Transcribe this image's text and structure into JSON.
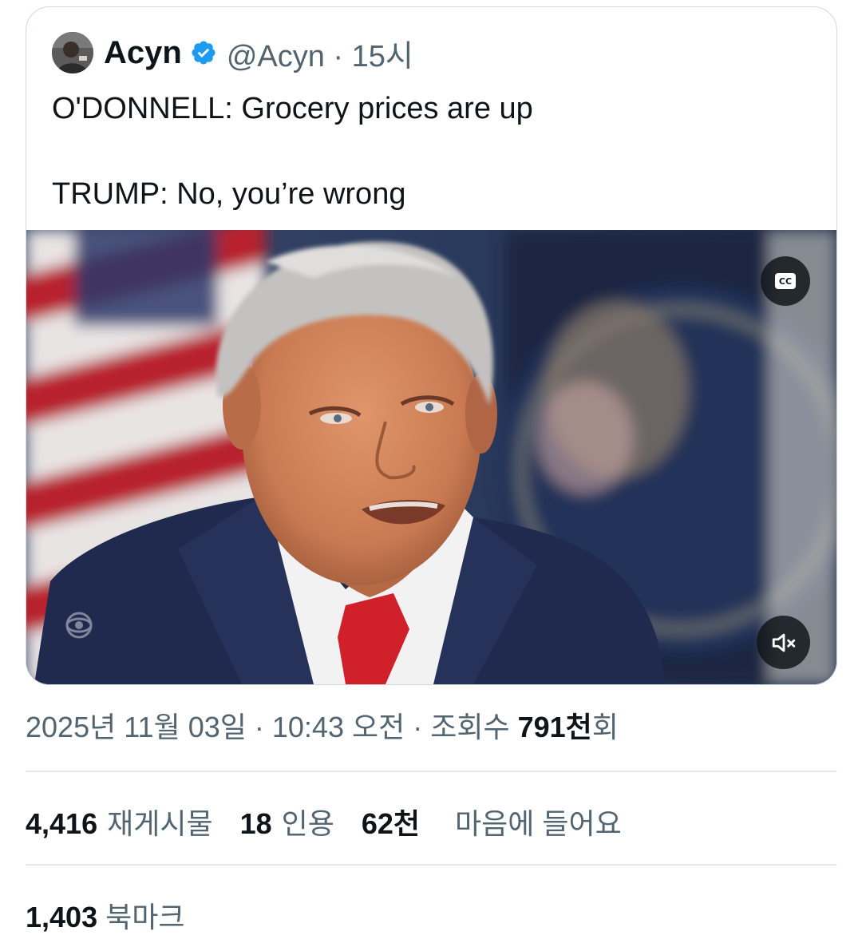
{
  "quoted_tweet": {
    "display_name": "Acyn",
    "handle": "@Acyn",
    "time_sep": " · ",
    "time": "15시",
    "text_line1": "O'DONNELL: Grocery prices are up",
    "text_line2": "TRUMP: No, you’re wrong",
    "media": {
      "cc_label": "CC",
      "cc_icon": "closed-captions-icon",
      "mute_icon": "speaker-muted-icon"
    }
  },
  "meta": {
    "date": "2025년 11월 03일",
    "sep1": " · ",
    "time": "10:43 오전",
    "sep2": " · ",
    "views_label": "조회수 ",
    "views_value": "791천",
    "views_suffix": "회"
  },
  "stats": {
    "reposts_count": "4,416",
    "reposts_label": "재게시물",
    "quotes_count": "18",
    "quotes_label": "인용",
    "likes_count": "62천",
    "likes_label": "마음에 들어요",
    "bookmarks_count": "1,403",
    "bookmarks_label": "북마크"
  },
  "colors": {
    "text_primary": "#0f1419",
    "text_secondary": "#536471",
    "verified_blue": "#1d9bf0",
    "border": "#cfd9de"
  }
}
